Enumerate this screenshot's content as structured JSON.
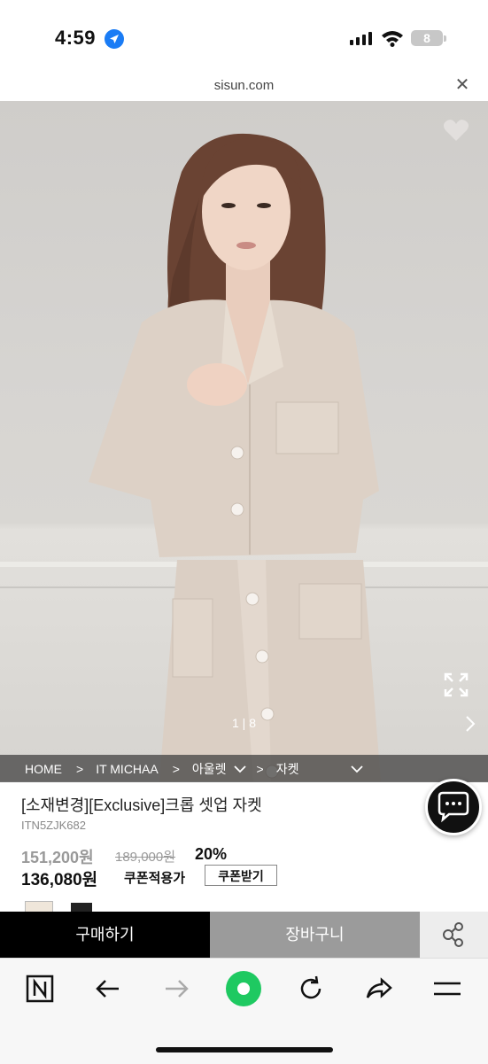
{
  "status_bar": {
    "time": "4:59",
    "battery": "8"
  },
  "browser": {
    "url": "sisun.com"
  },
  "gallery": {
    "counter": "1 | 8"
  },
  "breadcrumb": {
    "home": "HOME",
    "sep": ">",
    "brand": "IT MICHAA",
    "category": "아울렛",
    "subcategory": "자켓"
  },
  "product": {
    "title": "[소재변경][Exclusive]크롭 셋업 자켓",
    "code": "ITN5ZJK682",
    "price": "151,200원",
    "list_price": "189,000원",
    "discount": "20%",
    "coupon_price": "136,080원",
    "coupon_label": "쿠폰적용가",
    "coupon_button": "쿠폰받기",
    "swatches": [
      "#efe6da",
      "#222222"
    ]
  },
  "actions": {
    "buy": "구매하기",
    "cart": "장바구니"
  },
  "colors": {
    "accent_green": "#1ec961",
    "buy_bg": "#000000",
    "cart_bg": "#9b9b9b"
  }
}
